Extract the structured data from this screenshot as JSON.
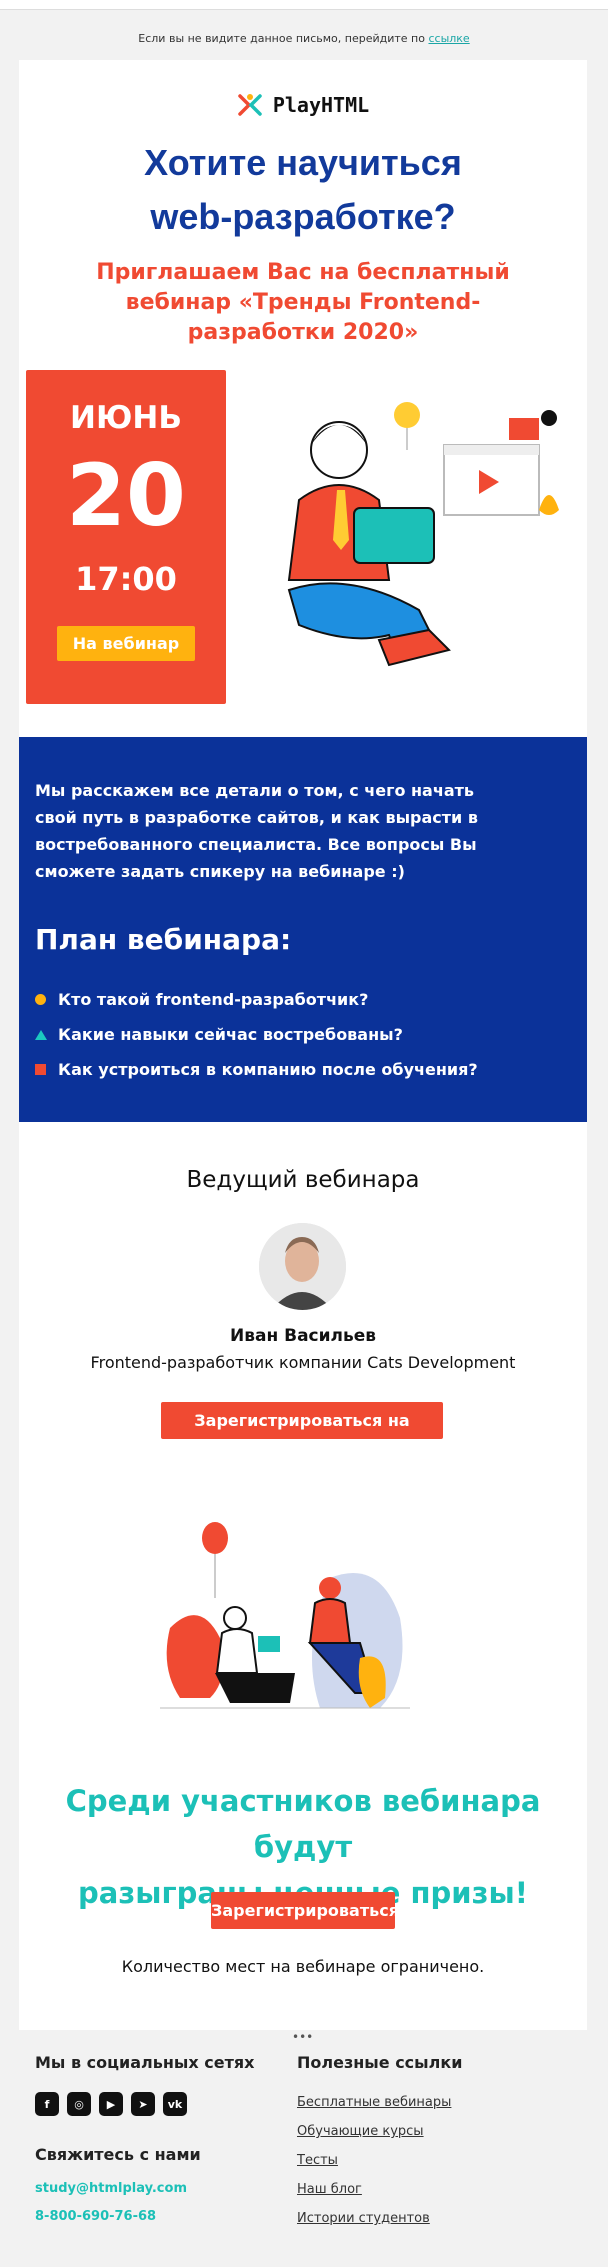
{
  "preheader": {
    "text": "Если вы не видите данное письмо, перейдите по",
    "link": "ссылке"
  },
  "brand": {
    "logo_text": "PlayHTML"
  },
  "hero": {
    "title_line1": "Хотите научиться",
    "title_line2": "web-разработке?",
    "subtitle": "Приглашаем Вас на бесплатный вебинар «Тренды Frontend-разработки 2020»"
  },
  "date": {
    "month": "ИЮНЬ",
    "day": "20",
    "time": "17:00",
    "button": "На вебинар"
  },
  "intro": {
    "text": "Мы расскажем все детали о том, с чего начать свой путь в разработке сайтов, и как вырасти в востребованного специалиста. Все вопросы Вы сможете задать спикеру на вебинаре :)"
  },
  "plan": {
    "title": "План вебинара:",
    "items": [
      "Кто такой frontend-разработчик?",
      "Какие навыки сейчас востребованы?",
      "Как устроиться в компанию после обучения?"
    ]
  },
  "speaker": {
    "section_title": "Ведущий вебинара",
    "name": "Иван Васильев",
    "role": "Frontend-разработчик компании Cats Development",
    "button": "Зарегистрироваться на вебинар"
  },
  "prize": {
    "line1": "Среди участников вебинара будут",
    "line2": "разыграны ценные призы!",
    "button": "Зарегистрироваться",
    "note": "Количество мест на вебинаре ограничено."
  },
  "footer": {
    "social_title": "Мы в социальных сетях",
    "social_icons": [
      "facebook-icon",
      "instagram-icon",
      "youtube-icon",
      "telegram-icon",
      "vk-icon"
    ],
    "contact_title": "Свяжитесь с нами",
    "email": "study@htmlplay.com",
    "phone": "8-800-690-76-68",
    "links_title": "Полезные ссылки",
    "links": [
      "Бесплатные вебинары",
      "Обучающие курсы",
      "Тесты",
      "Наш блог",
      "Истории студентов"
    ]
  },
  "colors": {
    "brand_blue": "#0b3299",
    "accent_red": "#f04a32",
    "accent_yellow": "#ffb20f",
    "accent_teal": "#1cc0b7"
  }
}
